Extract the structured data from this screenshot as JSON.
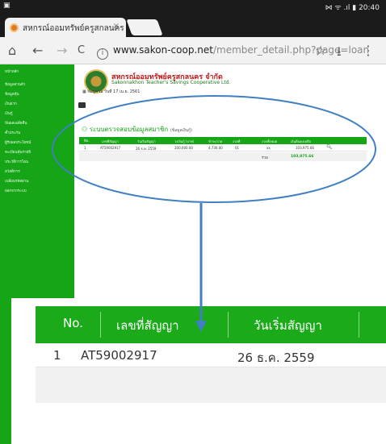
{
  "status_bar": {
    "left_icon": "image-icon",
    "right_text": "20:40",
    "status_icons": "⋈ ᯤ .ıl ▮"
  },
  "tab": {
    "title": "สหกรณ์ออมทรัพย์ครูสกลนคร จำ",
    "close": "×"
  },
  "toolbar": {
    "url_domain": "www.sakon-coop.net",
    "url_path": "/member_detail.php?page=loan",
    "home": "⌂",
    "back": "←",
    "forward": "→",
    "reload": "C",
    "star": "☆",
    "download": "⭳",
    "menu": "⋮",
    "info": "i"
  },
  "header": {
    "name_th": "สหกรณ์ออมทรัพย์ครูสกลนคร จำกัด",
    "name_en": "Sakonnakhon Teacher's Savings Cooperative Ltd.",
    "date_text": "ข้อมูล ณ วันที่ 17 เม.ย. 2561"
  },
  "sidebar": {
    "items": [
      "หน้าหลัก",
      "ข้อมูลส่วนตัว",
      "ข้อมูลหุ้น",
      "เงินฝาก",
      "เงินกู้",
      "ปันผลเฉลี่ยคืน",
      "ค้ำประกัน",
      "ผู้รับผลประโยชน์",
      "ทะเบียนหุ้นรายปี",
      "ประวัติการโอน",
      "สวัสดิการ",
      "เปลี่ยนรหัสผ่าน",
      "ออกจากระบบ"
    ]
  },
  "section": {
    "title": "ระบบตรวจสอบข้อมูลสมาชิก",
    "subtitle": "(ข้อมูลเงินกู้)"
  },
  "table": {
    "headers": [
      "No.",
      "เลขที่สัญญา",
      "วันเริ่มสัญญา",
      "วงเงินกู้ (บาท)",
      "ชำระ/งวด",
      "งวดที่",
      "งวดทั้งหมด",
      "เงินต้นคงเหลือ"
    ],
    "row": [
      "1",
      "AT59002917",
      "26 ธ.ค. 2559",
      "200,000.00",
      "4,730.00",
      "01",
      "xx",
      "103,975.66"
    ],
    "total_label": "รวม",
    "total_value": "103,975.66"
  },
  "zoom": {
    "headers": [
      "No.",
      "เลขที่สัญญา",
      "วันเริ่มสัญญา"
    ],
    "row": [
      "1",
      "AT59002917",
      "26 ธ.ค. 2559"
    ]
  },
  "colors": {
    "green": "#16a516",
    "title_red": "#c61a1a",
    "annotation_blue": "#3f7fc2"
  }
}
